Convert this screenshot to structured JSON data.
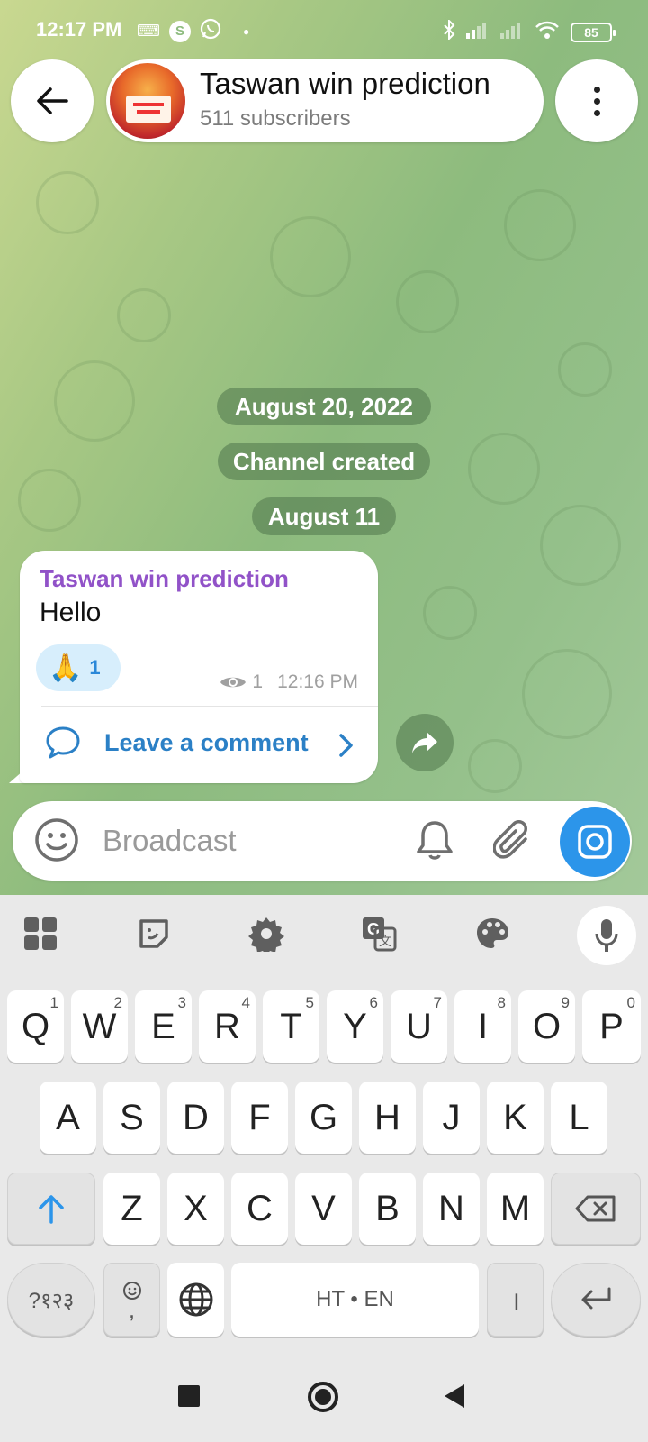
{
  "status_bar": {
    "time": "12:17 PM",
    "battery": "85",
    "icons": [
      "keyboard-icon",
      "skype-icon",
      "whatsapp-icon",
      "dot-icon",
      "bluetooth-icon",
      "signal-icon",
      "signal-icon-2",
      "wifi-icon",
      "battery-icon"
    ]
  },
  "header": {
    "channel_name": "Taswan win prediction",
    "subscribers": "511 subscribers"
  },
  "service_messages": {
    "date_1": "August 20, 2022",
    "created": "Channel created",
    "date_2": "August 11"
  },
  "message": {
    "author": "Taswan win prediction",
    "text": "Hello",
    "reaction_emoji": "🙏",
    "reaction_count": "1",
    "views": "1",
    "time": "12:16 PM",
    "comment_label": "Leave a comment"
  },
  "input": {
    "placeholder": "Broadcast"
  },
  "keyboard": {
    "toolbar": [
      "apps-icon",
      "sticker-icon",
      "settings-icon",
      "translate-icon",
      "palette-icon",
      "mic-icon"
    ],
    "row1": [
      "Q",
      "W",
      "E",
      "R",
      "T",
      "Y",
      "U",
      "I",
      "O",
      "P"
    ],
    "row1_hints": [
      "1",
      "2",
      "3",
      "4",
      "5",
      "6",
      "7",
      "8",
      "9",
      "0"
    ],
    "row2": [
      "A",
      "S",
      "D",
      "F",
      "G",
      "H",
      "J",
      "K",
      "L"
    ],
    "row3": [
      "Z",
      "X",
      "C",
      "V",
      "B",
      "N",
      "M"
    ],
    "symbols_key": "?१२३",
    "emoji_comma_key": ",",
    "space_label": "HT • EN",
    "punct_key": "।"
  },
  "colors": {
    "accent": "#2c95ea",
    "author": "#9152c8",
    "link": "#2b80c6",
    "service_pill": "#4e744a"
  }
}
